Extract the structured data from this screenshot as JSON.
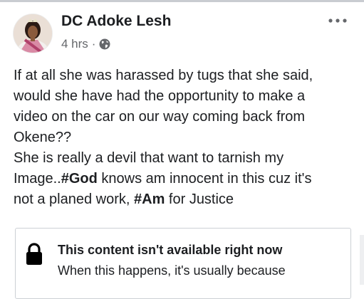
{
  "post": {
    "author": "DC Adoke Lesh",
    "time": "4 hrs",
    "separator": "·",
    "privacy_icon": "globe-icon",
    "more_icon": "more-options-icon",
    "lines": {
      "l1": "If at all she was harassed by tugs that she said,",
      "l2": "would she have had the opportunity to make a",
      "l3": "video on the car on our way coming back from",
      "l4": "Okene??",
      "l5": "She is really a devil that want to tarnish my",
      "l6_prefix": "Image..",
      "l6_hashtag": "#God",
      "l6_suffix": " knows am innocent in this cuz it's",
      "l7_prefix": "not a planed work, ",
      "l7_hashtag": "#Am",
      "l7_suffix": " for Justice"
    }
  },
  "shared_notice": {
    "icon": "lock-icon",
    "title": "This content isn't available right now",
    "body": "When this happens, it's usually because"
  }
}
